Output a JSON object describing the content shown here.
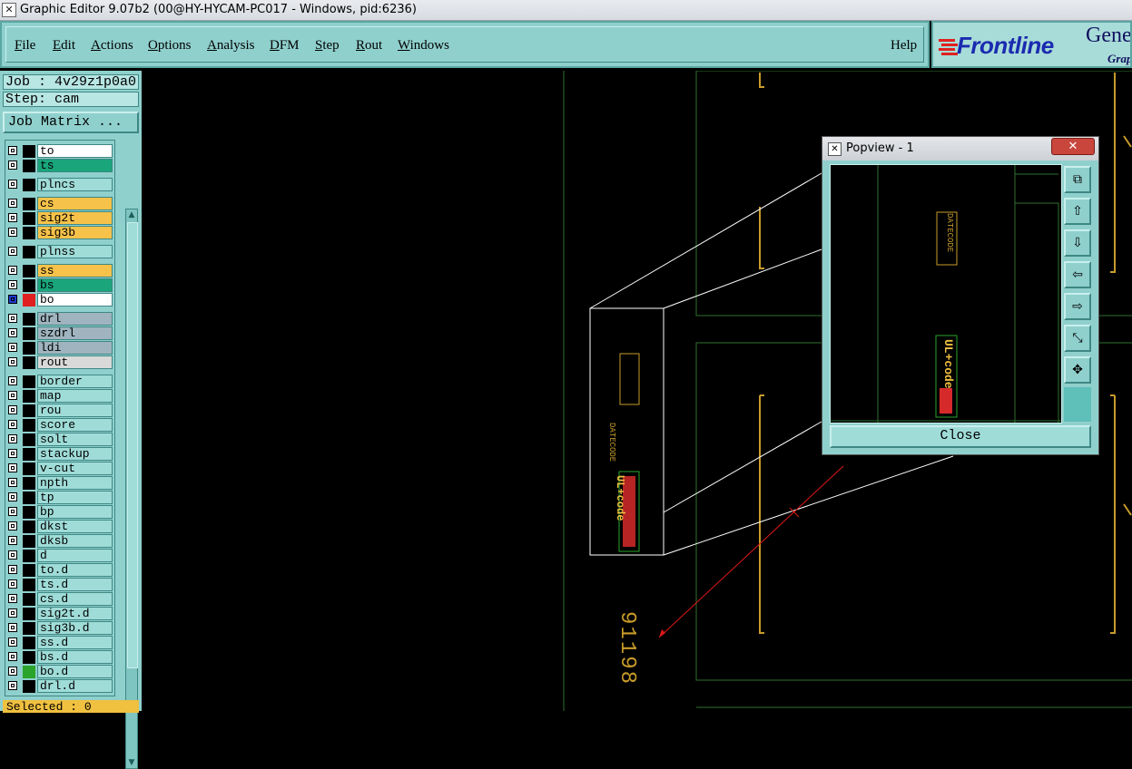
{
  "window": {
    "title": "Graphic Editor 9.07b2 (00@HY-HYCAM-PC017 - Windows, pid:6236)",
    "icon": "x-window-icon"
  },
  "menu": {
    "items": [
      {
        "label": "File",
        "key": "F",
        "rest": "ile"
      },
      {
        "label": "Edit",
        "key": "E",
        "rest": "dit"
      },
      {
        "label": "Actions",
        "key": "A",
        "rest": "ctions"
      },
      {
        "label": "Options",
        "key": "O",
        "rest": "ptions"
      },
      {
        "label": "Analysis",
        "key": "A",
        "rest": "nalysis"
      },
      {
        "label": "DFM",
        "key": "D",
        "rest": "FM"
      },
      {
        "label": "Step",
        "key": "S",
        "rest": "tep"
      },
      {
        "label": "Rout",
        "key": "R",
        "rest": "out"
      },
      {
        "label": "Windows",
        "key": "W",
        "rest": "indows"
      }
    ],
    "help": "Help"
  },
  "logo": {
    "brand": "Frontline",
    "line1": "Gene",
    "line2": "Grap"
  },
  "job": {
    "job_label": "Job : 4v29z1p0a0",
    "step_label": "Step: cam",
    "matrix_button": "Job Matrix ..."
  },
  "layers": [
    {
      "name": "to",
      "color": "#ffffff"
    },
    {
      "name": "ts",
      "color": "#1aa57a"
    },
    {
      "name": "plncs",
      "color": "#9fdcd8"
    },
    {
      "name": "cs",
      "color": "#f7c24a"
    },
    {
      "name": "sig2t",
      "color": "#f7c24a"
    },
    {
      "name": "sig3b",
      "color": "#f7c24a"
    },
    {
      "name": "plnss",
      "color": "#9fdcd8"
    },
    {
      "name": "ss",
      "color": "#f7c24a"
    },
    {
      "name": "bs",
      "color": "#1aa57a"
    },
    {
      "name": "bo",
      "color": "#ffffff",
      "active": true
    },
    {
      "name": "drl",
      "color": "#9fb4bf"
    },
    {
      "name": "szdrl",
      "color": "#9fb4bf"
    },
    {
      "name": "ldi",
      "color": "#9fb4bf"
    },
    {
      "name": "rout",
      "color": "#d9d9d9"
    },
    {
      "name": "border",
      "color": "#9fdcd8"
    },
    {
      "name": "map",
      "color": "#9fdcd8"
    },
    {
      "name": "rou",
      "color": "#9fdcd8"
    },
    {
      "name": "score",
      "color": "#9fdcd8"
    },
    {
      "name": "solt",
      "color": "#9fdcd8"
    },
    {
      "name": "stackup",
      "color": "#9fdcd8"
    },
    {
      "name": "v-cut",
      "color": "#9fdcd8"
    },
    {
      "name": "npth",
      "color": "#9fdcd8"
    },
    {
      "name": "tp",
      "color": "#9fdcd8"
    },
    {
      "name": "bp",
      "color": "#9fdcd8"
    },
    {
      "name": "dkst",
      "color": "#9fdcd8"
    },
    {
      "name": "dksb",
      "color": "#9fdcd8"
    },
    {
      "name": "d",
      "color": "#9fdcd8"
    },
    {
      "name": "to.d",
      "color": "#9fdcd8"
    },
    {
      "name": "ts.d",
      "color": "#9fdcd8"
    },
    {
      "name": "cs.d",
      "color": "#9fdcd8"
    },
    {
      "name": "sig2t.d",
      "color": "#9fdcd8"
    },
    {
      "name": "sig3b.d",
      "color": "#9fdcd8"
    },
    {
      "name": "ss.d",
      "color": "#9fdcd8"
    },
    {
      "name": "bs.d",
      "color": "#9fdcd8"
    },
    {
      "name": "bo.d",
      "color": "#9fdcd8",
      "swatch": "#2aa42a"
    },
    {
      "name": "drl.d",
      "color": "#9fdcd8"
    }
  ],
  "status": {
    "text": "Selected : 0"
  },
  "canvas": {
    "board_number": "91198",
    "datecode_label": "DATECODE",
    "ul_label": "UL+code"
  },
  "popview": {
    "title": "Popview - 1",
    "close_x": "✕",
    "close_button": "Close",
    "tools": [
      "zoom-fit-icon",
      "pan-up-icon",
      "pan-down-icon",
      "pan-left-icon",
      "pan-right-icon",
      "zoom-out-icon",
      "zoom-in-icon"
    ]
  }
}
